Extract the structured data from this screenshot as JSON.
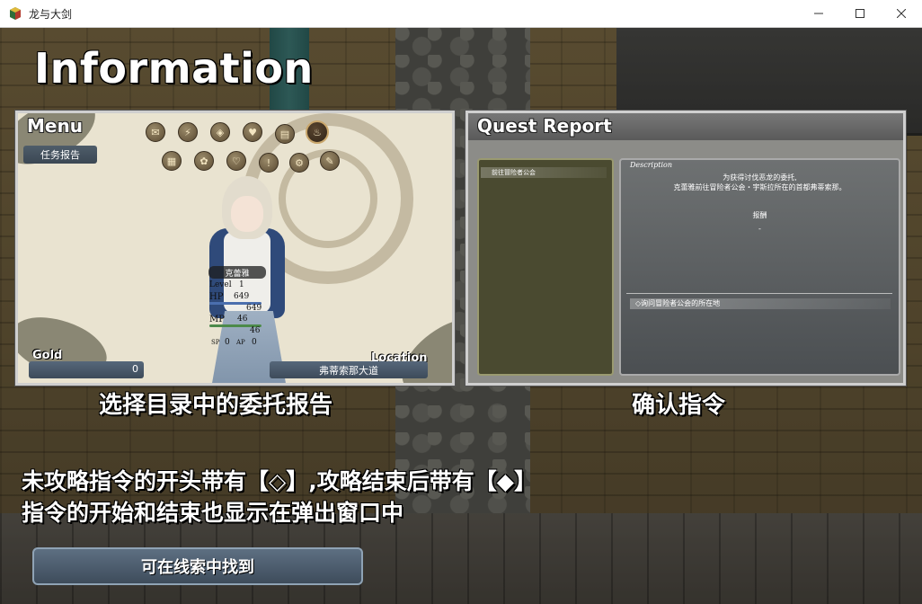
{
  "window": {
    "title": "龙与大剑",
    "controls": {
      "minimize": "—",
      "maximize": "☐",
      "close": "✕"
    }
  },
  "screen": {
    "heading": "Information",
    "left_caption": "选择目录中的委托报告",
    "right_caption": "确认指令",
    "note_line1": "未攻略指令的开头带有【◇】,攻略结束后带有【◆】",
    "note_line2": "指令的开始和结束也显示在弹出窗口中",
    "button_label": "可在线索中找到"
  },
  "menu_panel": {
    "title": "Menu",
    "quest_tag": "任务报告",
    "character_name": "克蕾雅",
    "level_label": "Level",
    "level_value": "1",
    "hp_label": "HP",
    "hp_current": "649",
    "hp_max": "649",
    "mp_label": "MP",
    "mp_current": "46",
    "mp_max": "46",
    "sp_label": "SP",
    "sp_value": "0",
    "ap_label": "AP",
    "ap_value": "0",
    "gold_label": "Gold",
    "gold_value": "0",
    "location_label": "Location",
    "location_value": "弗蒂索那大道",
    "menu_icons": [
      "bag-icon",
      "skill-icon",
      "equip-icon",
      "heart-icon",
      "book-icon",
      "potion-icon",
      "map-icon",
      "gift-icon",
      "love-icon",
      "alert-icon",
      "gear-icon",
      "save-icon"
    ]
  },
  "quest_panel": {
    "title": "Quest Report",
    "list_item": "前往冒险者公会",
    "desc_title": "Description",
    "desc_line1": "为获得讨伐恶龙的委托,",
    "desc_line2": "克蕾雅前往冒险者公会・宇斯拉所在的首都弗蒂索那。",
    "reward_label": "报酬",
    "reward_value": "-",
    "objective": "◇询问冒险者公会的所在地"
  },
  "colors": {
    "accent_button": "#4e5f71",
    "panel_border": "#cfcfcf",
    "quest_list_bg": "#4a4a30"
  }
}
